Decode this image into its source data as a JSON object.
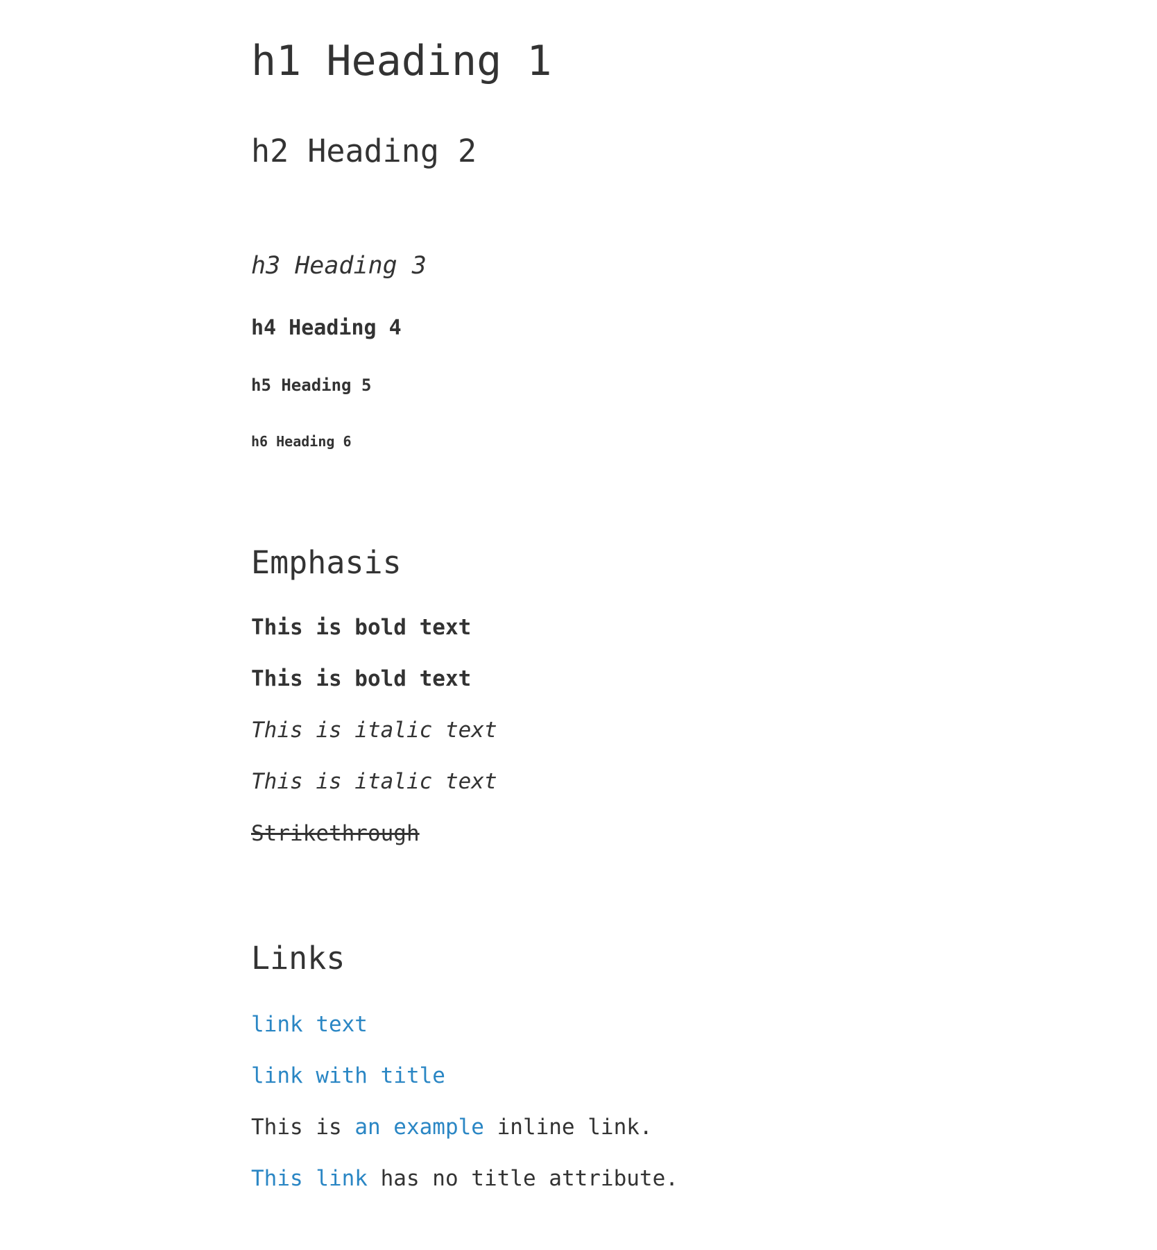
{
  "headings": {
    "h1": "h1 Heading 1",
    "h2": "h2 Heading 2",
    "h3": "h3 Heading 3",
    "h4": "h4 Heading 4",
    "h5": "h5 Heading 5",
    "h6": "h6 Heading 6"
  },
  "emphasis": {
    "title": "Emphasis",
    "bold_1": "This is bold text",
    "bold_2": "This is bold text",
    "italic_1": "This is italic text",
    "italic_2": "This is italic text",
    "strikethrough": "Strikethrough"
  },
  "links": {
    "title": "Links",
    "link_text": "link text",
    "link_with_title": "link with title",
    "inline": {
      "before": "This is ",
      "link": "an example",
      "after": " inline link."
    },
    "no_title": {
      "link": "This link",
      "after": " has no title attribute."
    }
  },
  "colors": {
    "text": "#333333",
    "link": "#2a86c4",
    "background": "#ffffff"
  }
}
